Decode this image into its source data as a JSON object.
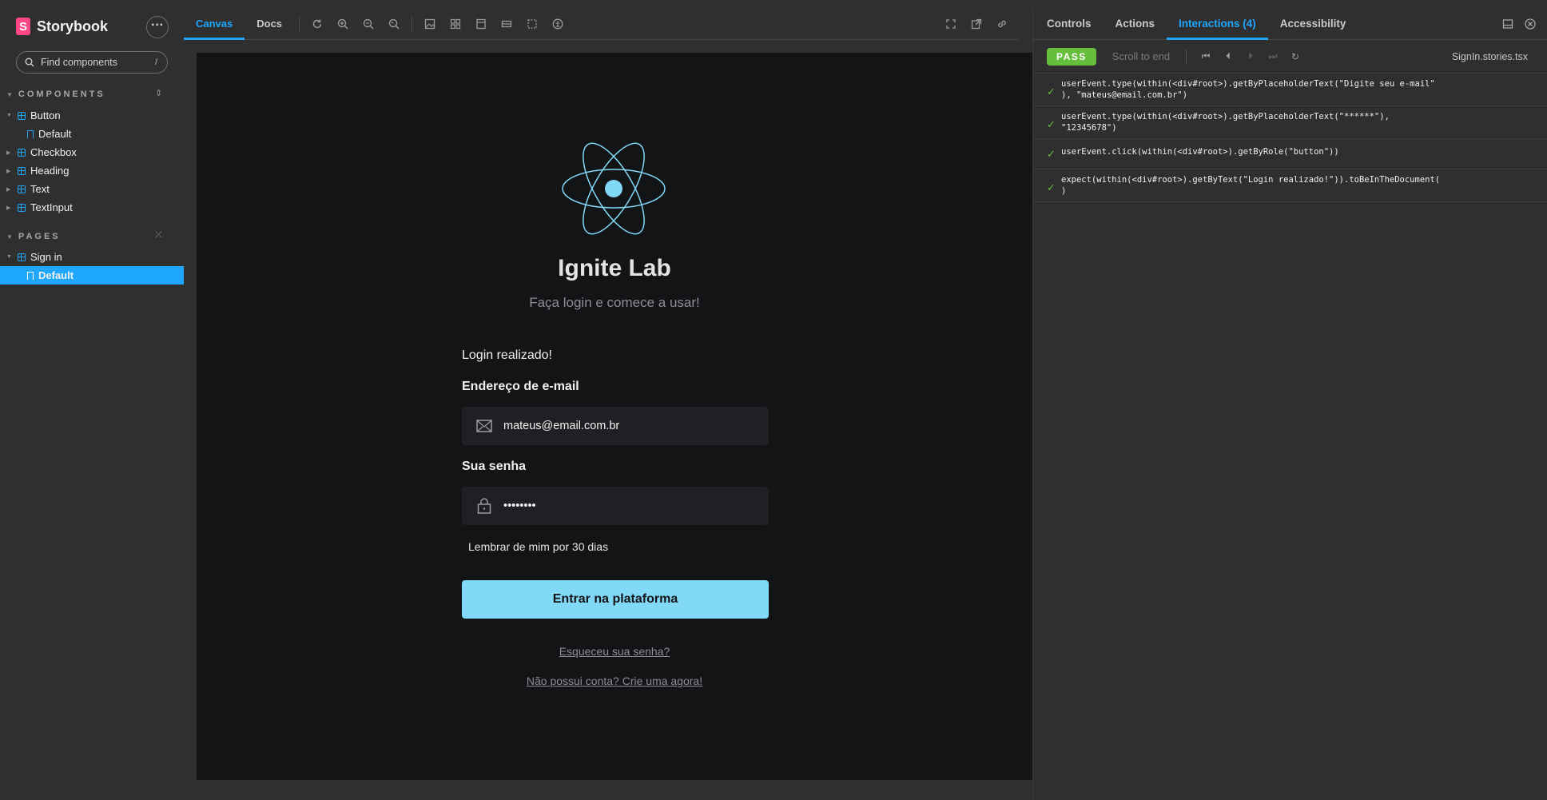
{
  "sidebar": {
    "brand": "Storybook",
    "menu_icon": "more-icon",
    "search_placeholder": "Find components",
    "search_shortcut": "/",
    "components_title": "COMPONENTS",
    "pages_title": "PAGES",
    "items": [
      {
        "label": "Button"
      },
      {
        "label": "Default"
      },
      {
        "label": "Checkbox"
      },
      {
        "label": "Heading"
      },
      {
        "label": "Text"
      },
      {
        "label": "TextInput"
      },
      {
        "label": "Sign in"
      },
      {
        "label": "Default"
      }
    ]
  },
  "toolbar": {
    "tabs": [
      {
        "label": "Canvas"
      },
      {
        "label": "Docs"
      }
    ]
  },
  "canvas": {
    "title": "Ignite Lab",
    "subtitle": "Faça login e comece a usar!",
    "success_message": "Login realizado!",
    "email_label": "Endereço de e-mail",
    "email_value": "mateus@email.com.br",
    "password_label": "Sua senha",
    "password_value": "12345678",
    "remember_label": "Lembrar de mim por 30 dias",
    "submit_label": "Entrar na plataforma",
    "forgot_link": "Esqueceu sua senha?",
    "signup_link": "Não possui conta? Crie uma agora!"
  },
  "panel": {
    "tabs": [
      {
        "label": "Controls"
      },
      {
        "label": "Actions"
      },
      {
        "label": "Interactions (4)"
      },
      {
        "label": "Accessibility"
      }
    ],
    "status": "PASS",
    "scroll_to_end": "Scroll to end",
    "file_name": "SignIn.stories.tsx"
  },
  "interactions": [
    {
      "code": "userEvent.type(within(<div#root>).getByPlaceholderText(\"Digite seu e-mail\"\n), \"mateus@email.com.br\")"
    },
    {
      "code": "userEvent.type(within(<div#root>).getByPlaceholderText(\"******\"),\n\"12345678\")"
    },
    {
      "code": "userEvent.click(within(<div#root>).getByRole(\"button\"))"
    },
    {
      "code": "expect(within(<div#root>).getByText(\"Login realizado!\")).toBeInTheDocument(\n)"
    }
  ],
  "colors": {
    "accent": "#1ea7fd",
    "brand": "#ff4785",
    "pass": "#66bf3c",
    "canvas_bg": "#131416",
    "button_bg": "#81d8f7"
  }
}
